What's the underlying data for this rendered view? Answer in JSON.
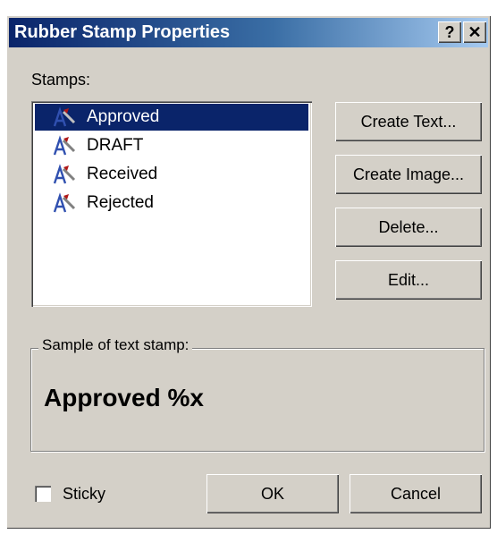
{
  "window": {
    "title": "Rubber Stamp Properties",
    "help_label": "?",
    "close_label": "✕"
  },
  "stamps": {
    "label": "Stamps:",
    "items": [
      {
        "label": "Approved",
        "selected": true
      },
      {
        "label": "DRAFT",
        "selected": false
      },
      {
        "label": "Received",
        "selected": false
      },
      {
        "label": "Rejected",
        "selected": false
      }
    ]
  },
  "buttons": {
    "create_text": "Create Text...",
    "create_image": "Create Image...",
    "delete": "Delete...",
    "edit": "Edit..."
  },
  "sample": {
    "caption": "Sample of text stamp:",
    "text": "Approved %x"
  },
  "footer": {
    "sticky_label": "Sticky",
    "sticky_checked": false,
    "ok": "OK",
    "cancel": "Cancel"
  },
  "colors": {
    "title_start": "#0a246a",
    "title_end": "#a6caf0",
    "selection": "#0a246a",
    "face": "#d4d0c8"
  },
  "icons": {
    "stamp": "stamp-icon"
  }
}
